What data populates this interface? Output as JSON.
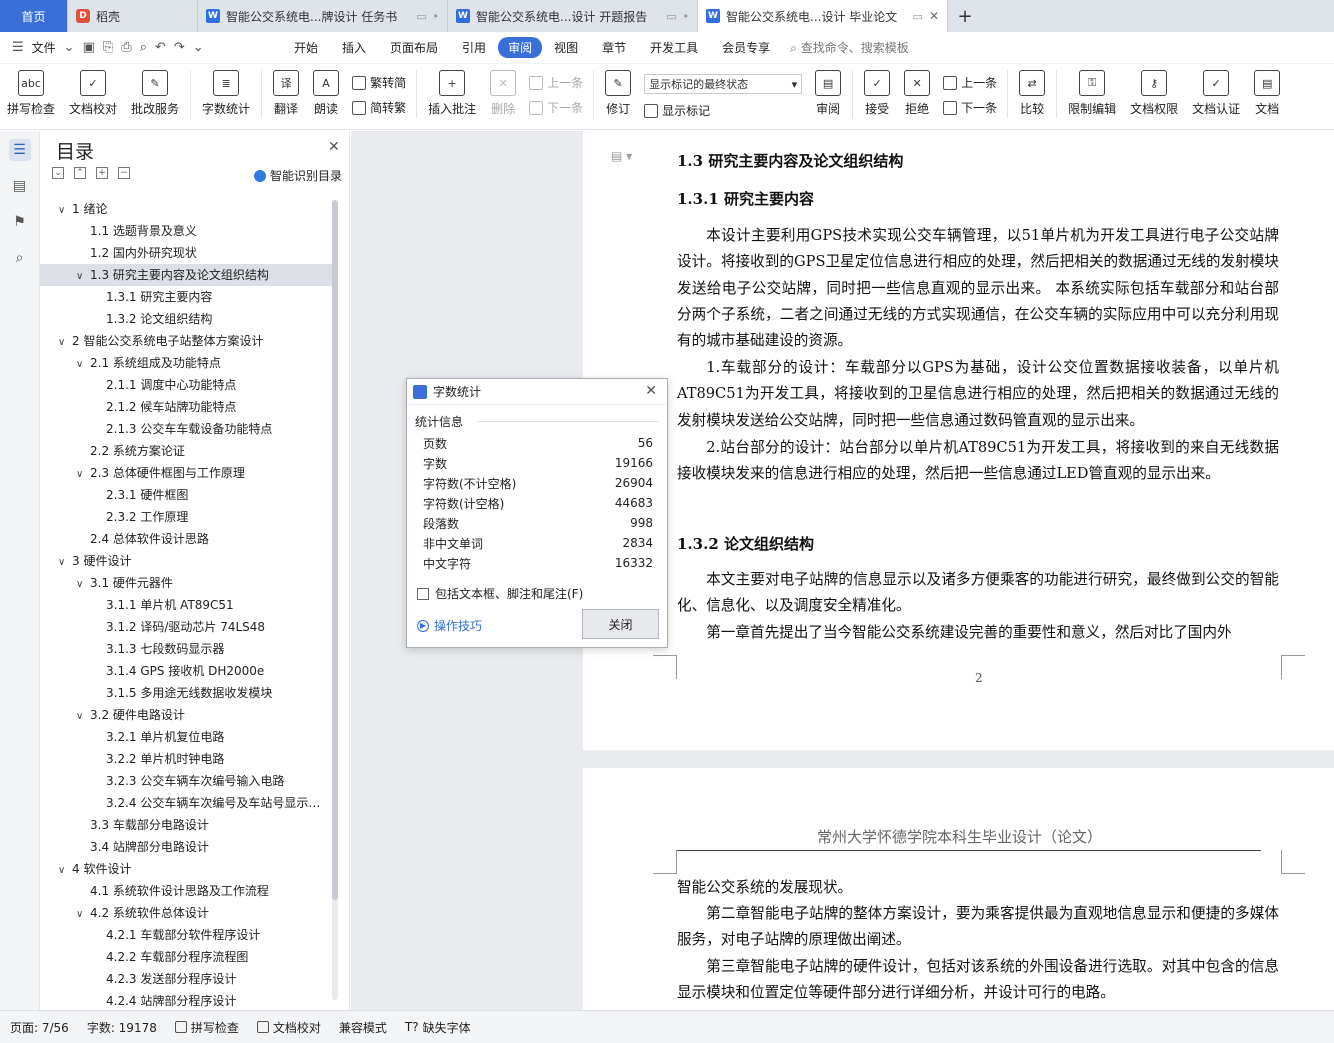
{
  "tabs": [
    {
      "label": "首页",
      "kind": "home"
    },
    {
      "label": "稻壳",
      "kind": "daoke"
    },
    {
      "label": "智能公交系统电...牌设计 任务书",
      "kind": "doc"
    },
    {
      "label": "智能公交系统电...设计 开题报告",
      "kind": "doc"
    },
    {
      "label": "智能公交系统电...设计 毕业论文",
      "kind": "doc",
      "active": true
    }
  ],
  "menu": {
    "file": "文件",
    "items": [
      "开始",
      "插入",
      "页面布局",
      "引用",
      "审阅",
      "视图",
      "章节",
      "开发工具",
      "会员专享"
    ],
    "active": "审阅",
    "search": "查找命令、搜索模板"
  },
  "toolbar": {
    "spellcheck": "拼写检查",
    "doccheck": "文档校对",
    "batch": "批改服务",
    "wordcount": "字数统计",
    "translate": "翻译",
    "read": "朗读",
    "trad": "繁转简",
    "simp": "简转繁",
    "insert_comment": "插入批注",
    "delete": "删除",
    "prev": "上一条",
    "next": "下一条",
    "track": "修订",
    "markup_select": "显示标记的最终状态",
    "show_markup": "显示标记",
    "review": "审阅",
    "accept": "接受",
    "reject": "拒绝",
    "prev2": "上一条",
    "next2": "下一条",
    "compare": "比较",
    "restrict": "限制编辑",
    "permission": "文档权限",
    "certify": "文档认证",
    "last": "文档"
  },
  "toc": {
    "title": "目录",
    "smart": "智能识别目录",
    "items": [
      {
        "level": 1,
        "text": "1  绪论",
        "exp": true
      },
      {
        "level": 2,
        "text": "1.1  选题背景及意义"
      },
      {
        "level": 2,
        "text": "1.2  国内外研究现状"
      },
      {
        "level": 2,
        "text": "1.3  研究主要内容及论文组织结构",
        "exp": true,
        "sel": true
      },
      {
        "level": 3,
        "text": "1.3.1  研究主要内容"
      },
      {
        "level": 3,
        "text": "1.3.2  论文组织结构"
      },
      {
        "level": 1,
        "text": "2  智能公交系统电子站整体方案设计",
        "exp": true
      },
      {
        "level": 2,
        "text": "2.1  系统组成及功能特点",
        "exp": true
      },
      {
        "level": 3,
        "text": "2.1.1  调度中心功能特点"
      },
      {
        "level": 3,
        "text": "2.1.2  候车站牌功能特点"
      },
      {
        "level": 3,
        "text": "2.1.3  公交车车载设备功能特点"
      },
      {
        "level": 2,
        "text": "2.2  系统方案论证"
      },
      {
        "level": 2,
        "text": "2.3  总体硬件框图与工作原理",
        "exp": true
      },
      {
        "level": 3,
        "text": "2.3.1  硬件框图"
      },
      {
        "level": 3,
        "text": "2.3.2  工作原理"
      },
      {
        "level": 2,
        "text": "2.4  总体软件设计思路"
      },
      {
        "level": 1,
        "text": "3  硬件设计",
        "exp": true
      },
      {
        "level": 2,
        "text": "3.1 硬件元器件",
        "exp": true
      },
      {
        "level": 3,
        "text": "3.1.1  单片机 AT89C51"
      },
      {
        "level": 3,
        "text": "3.1.2  译码/驱动芯片 74LS48"
      },
      {
        "level": 3,
        "text": "3.1.3  七段数码显示器"
      },
      {
        "level": 3,
        "text": "3.1.4 GPS 接收机 DH2000e"
      },
      {
        "level": 3,
        "text": "3.1.5  多用途无线数据收发模块"
      },
      {
        "level": 2,
        "text": "3.2  硬件电路设计",
        "exp": true
      },
      {
        "level": 3,
        "text": "3.2.1  单片机复位电路"
      },
      {
        "level": 3,
        "text": "3.2.2  单片机时钟电路"
      },
      {
        "level": 3,
        "text": "3.2.3  公交车辆车次编号输入电路"
      },
      {
        "level": 3,
        "text": "3.2.4  公交车辆车次编号及车站号显示电路"
      },
      {
        "level": 2,
        "text": "3.3  车载部分电路设计"
      },
      {
        "level": 2,
        "text": "3.4  站牌部分电路设计"
      },
      {
        "level": 1,
        "text": "4  软件设计",
        "exp": true
      },
      {
        "level": 2,
        "text": "4.1  系统软件设计思路及工作流程"
      },
      {
        "level": 2,
        "text": "4.2  系统软件总体设计",
        "exp": true
      },
      {
        "level": 3,
        "text": "4.2.1  车载部分软件程序设计"
      },
      {
        "level": 3,
        "text": "4.2.2  车载部分程序流程图"
      },
      {
        "level": 3,
        "text": "4.2.3  发送部分程序设计"
      },
      {
        "level": 3,
        "text": "4.2.4  站牌部分程序设计"
      }
    ]
  },
  "doc": {
    "h13": "1.3  研究主要内容及论文组织结构",
    "h131": "1.3.1  研究主要内容",
    "p1": "本设计主要利用GPS技术实现公交车辆管理，以51单片机为开发工具进行电子公交站牌设计。将接收到的GPS卫星定位信息进行相应的处理，然后把相关的数据通过无线的发射模块发送给电子公交站牌，同时把一些信息直观的显示出来。 本系统实际包括车载部分和站台部分两个子系统，二者之间通过无线的方式实现通信，在公交车辆的实际应用中可以充分利用现有的城市基础建设的资源。",
    "p2": "1.车载部分的设计：车载部分以GPS为基础，设计公交位置数据接收装备，以单片机AT89C51为开发工具，将接收到的卫星信息进行相应的处理，然后把相关的数据通过无线的发射模块发送给公交站牌，同时把一些信息通过数码管直观的显示出来。",
    "p3": "2.站台部分的设计：站台部分以单片机AT89C51为开发工具，将接收到的来自无线数据接收模块发来的信息进行相应的处理，然后把一些信息通过LED管直观的显示出来。",
    "h132": "1.3.2  论文组织结构",
    "p4": "本文主要对电子站牌的信息显示以及诸多方便乘客的功能进行研究，最终做到公交的智能化、信息化、以及调度安全精准化。",
    "p5": "第一章首先提出了当今智能公交系统建设完善的重要性和意义，然后对比了国内外",
    "page_num": "2",
    "header": "常州大学怀德学院本科生毕业设计（论文）",
    "p6": "智能公交系统的发展现状。",
    "p7": "第二章智能电子站牌的整体方案设计，要为乘客提供最为直观地信息显示和便捷的多媒体服务，对电子站牌的原理做出阐述。",
    "p8": "第三章智能电子站牌的硬件设计，包括对该系统的外围设备进行选取。对其中包含的信息显示模块和位置定位等硬件部分进行详细分析，并设计可行的电路。"
  },
  "wordcount": {
    "title": "字数统计",
    "section": "统计信息",
    "rows": [
      {
        "label": "页数",
        "value": "56"
      },
      {
        "label": "字数",
        "value": "19166"
      },
      {
        "label": "字符数(不计空格)",
        "value": "26904"
      },
      {
        "label": "字符数(计空格)",
        "value": "44683"
      },
      {
        "label": "段落数",
        "value": "998"
      },
      {
        "label": "非中文单词",
        "value": "2834"
      },
      {
        "label": "中文字符",
        "value": "16332"
      }
    ],
    "checkbox": "包括文本框、脚注和尾注(F)",
    "tips": "操作技巧",
    "close": "关闭"
  },
  "status": {
    "page": "页面: 7/56",
    "words": "字数: 19178",
    "spell": "拼写检查",
    "check": "文档校对",
    "compat": "兼容模式",
    "missing_font": "缺失字体"
  }
}
